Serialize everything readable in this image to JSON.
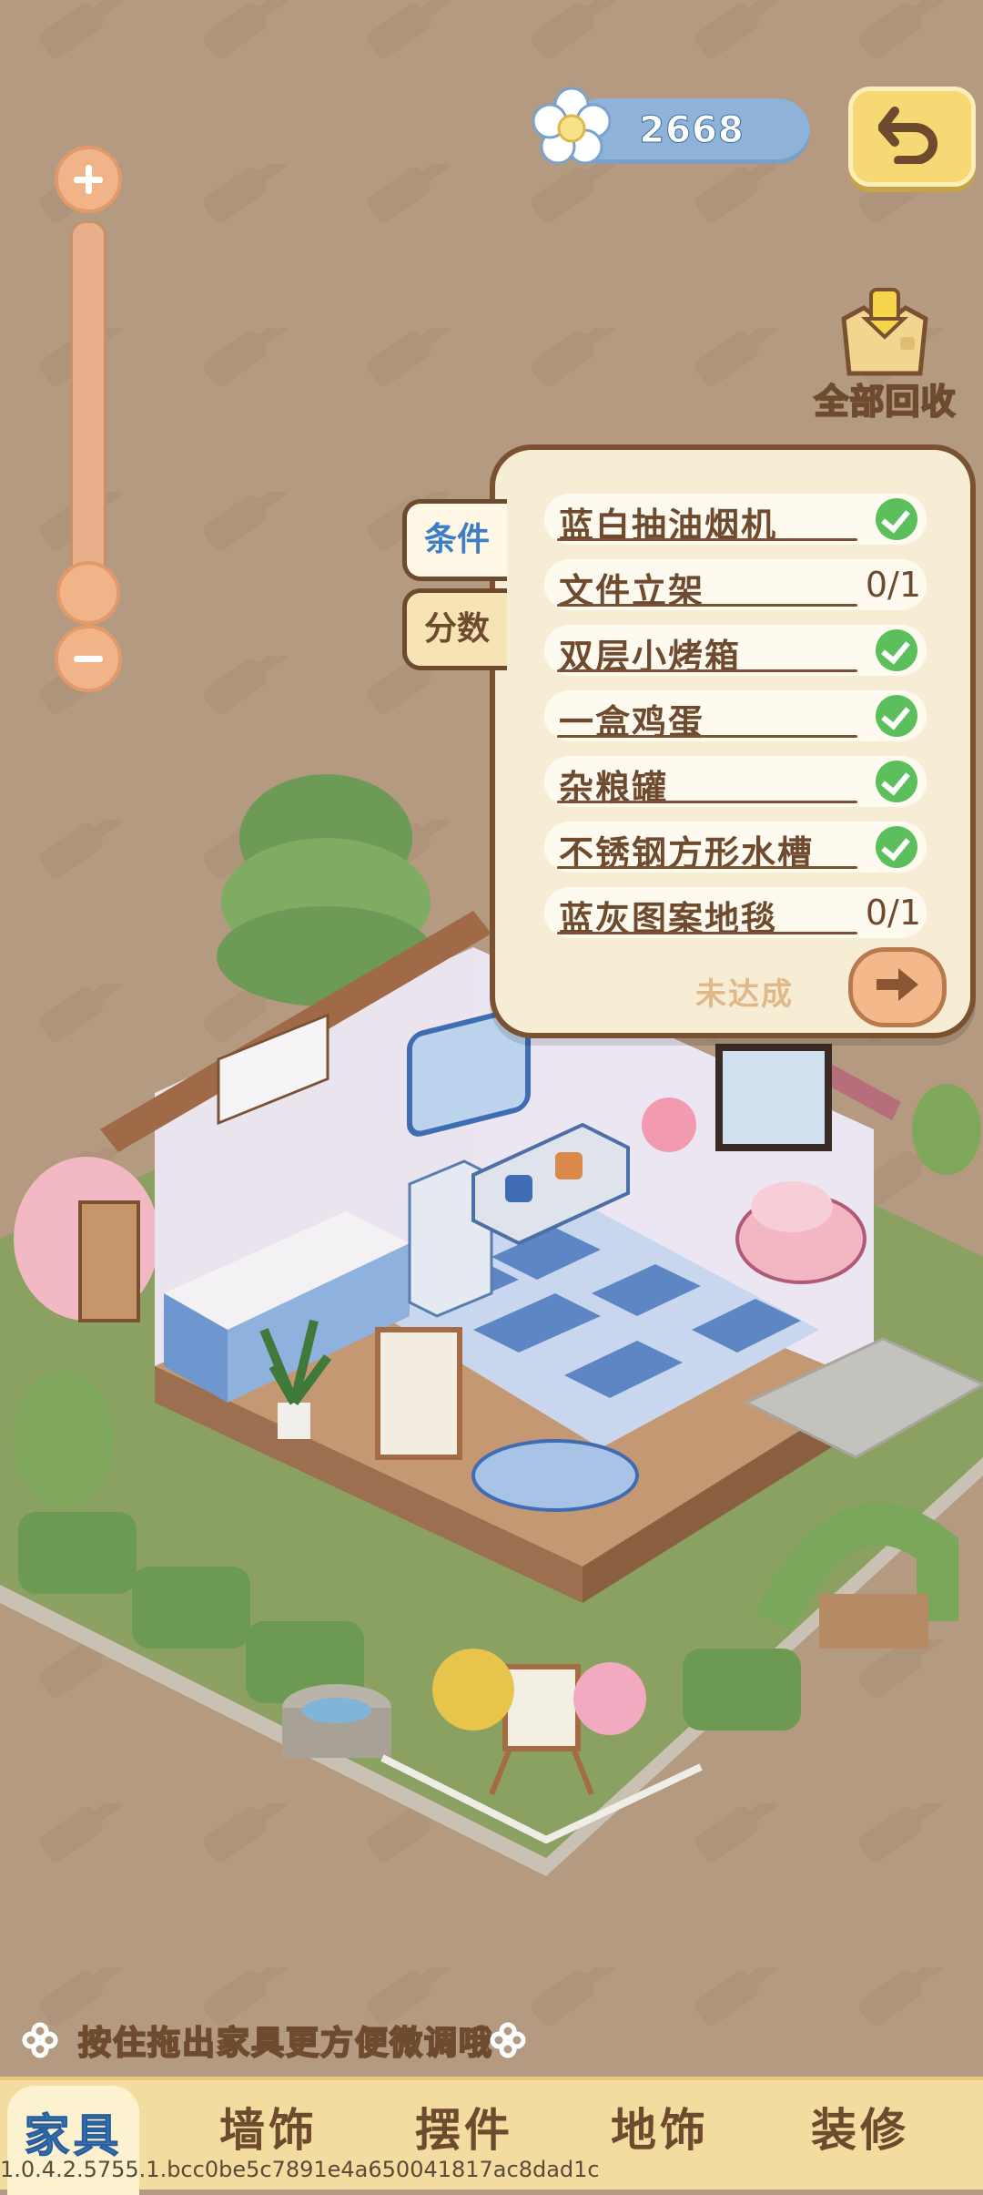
{
  "currency": {
    "value": "2668",
    "icon": "flower-icon"
  },
  "header": {
    "back_icon": "undo-arrow-icon",
    "recycle_label": "全部回收",
    "recycle_icon": "recycle-box-icon"
  },
  "zoom": {
    "plus_icon": "plus-icon",
    "minus_icon": "minus-icon",
    "level": 0.0
  },
  "panel": {
    "tabs": [
      {
        "label": "条件",
        "active": true
      },
      {
        "label": "分数",
        "active": false
      }
    ],
    "conditions": [
      {
        "name": "蓝白抽油烟机",
        "done": true,
        "count": ""
      },
      {
        "name": "文件立架",
        "done": false,
        "count": "0/1"
      },
      {
        "name": "双层小烤箱",
        "done": true,
        "count": ""
      },
      {
        "name": "一盒鸡蛋",
        "done": true,
        "count": ""
      },
      {
        "name": "杂粮罐",
        "done": true,
        "count": ""
      },
      {
        "name": "不锈钢方形水槽",
        "done": true,
        "count": ""
      },
      {
        "name": "蓝灰图案地毯",
        "done": false,
        "count": "0/1"
      }
    ],
    "status": "未达成",
    "next_icon": "arrow-right-icon"
  },
  "hint": {
    "text": "按住拖出家具更方便微调哦"
  },
  "bottom_tabs": [
    {
      "label": "家具",
      "active": true
    },
    {
      "label": "墙饰",
      "active": false
    },
    {
      "label": "摆件",
      "active": false
    },
    {
      "label": "地饰",
      "active": false
    },
    {
      "label": "装修",
      "active": false
    }
  ],
  "version": "1.0.4.2.5755.1.bcc0be5c7891e4a650041817ac8dad1c",
  "colors": {
    "background": "#b39a80",
    "accent_blue": "#3a7ec8",
    "brown": "#6e4a2e",
    "check_green": "#5bc05b"
  }
}
